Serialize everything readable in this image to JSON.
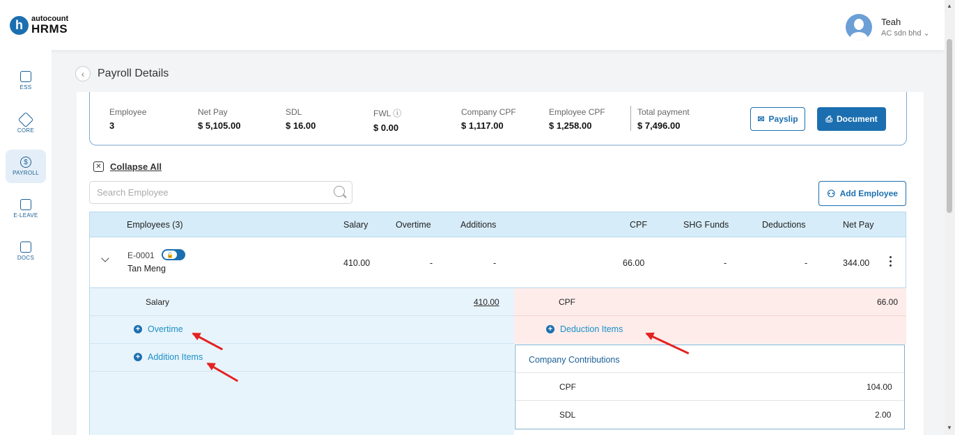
{
  "brand": {
    "top": "autocount",
    "bottom": "HRMS",
    "letter": "h"
  },
  "user": {
    "name": "Teah",
    "company": "AC sdn bhd"
  },
  "sidebar": {
    "items": [
      {
        "label": "ESS"
      },
      {
        "label": "CORE"
      },
      {
        "label": "PAYROLL"
      },
      {
        "label": "E-LEAVE"
      },
      {
        "label": "DOCS"
      }
    ]
  },
  "page": {
    "title": "Payroll Details"
  },
  "summary": {
    "employee_label": "Employee",
    "employee_value": "3",
    "netpay_label": "Net Pay",
    "netpay_value": "$ 5,105.00",
    "sdl_label": "SDL",
    "sdl_value": "$ 16.00",
    "fwl_label": "FWL",
    "fwl_value": "$ 0.00",
    "company_cpf_label": "Company CPF",
    "company_cpf_value": "$ 1,117.00",
    "employee_cpf_label": "Employee CPF",
    "employee_cpf_value": "$ 1,258.00",
    "total_label": "Total payment",
    "total_value": "$ 7,496.00",
    "payslip_label": "Payslip",
    "document_label": "Document"
  },
  "controls": {
    "collapse_label": "Collapse All",
    "search_placeholder": "Search Employee",
    "add_label": "Add Employee"
  },
  "table": {
    "headers": [
      "Employees (3)",
      "Salary",
      "Overtime",
      "Additions",
      "CPF",
      "SHG Funds",
      "Deductions",
      "Net Pay"
    ],
    "row": {
      "code": "E-0001",
      "name": "Tan Meng",
      "salary": "410.00",
      "overtime": "-",
      "additions": "-",
      "cpf": "66.00",
      "shg": "-",
      "deductions": "-",
      "netpay": "344.00"
    }
  },
  "detail": {
    "salary_label": "Salary",
    "salary_value": "410.00",
    "overtime_link": "Overtime",
    "addition_link": "Addition Items",
    "cpf_label": "CPF",
    "cpf_value": "66.00",
    "deduction_link": "Deduction Items",
    "contrib_title": "Company Contributions",
    "contrib_cpf_label": "CPF",
    "contrib_cpf_value": "104.00",
    "contrib_sdl_label": "SDL",
    "contrib_sdl_value": "2.00"
  },
  "colors": {
    "accent": "#1b6fb0",
    "annotation_arrow": "#e32222"
  }
}
